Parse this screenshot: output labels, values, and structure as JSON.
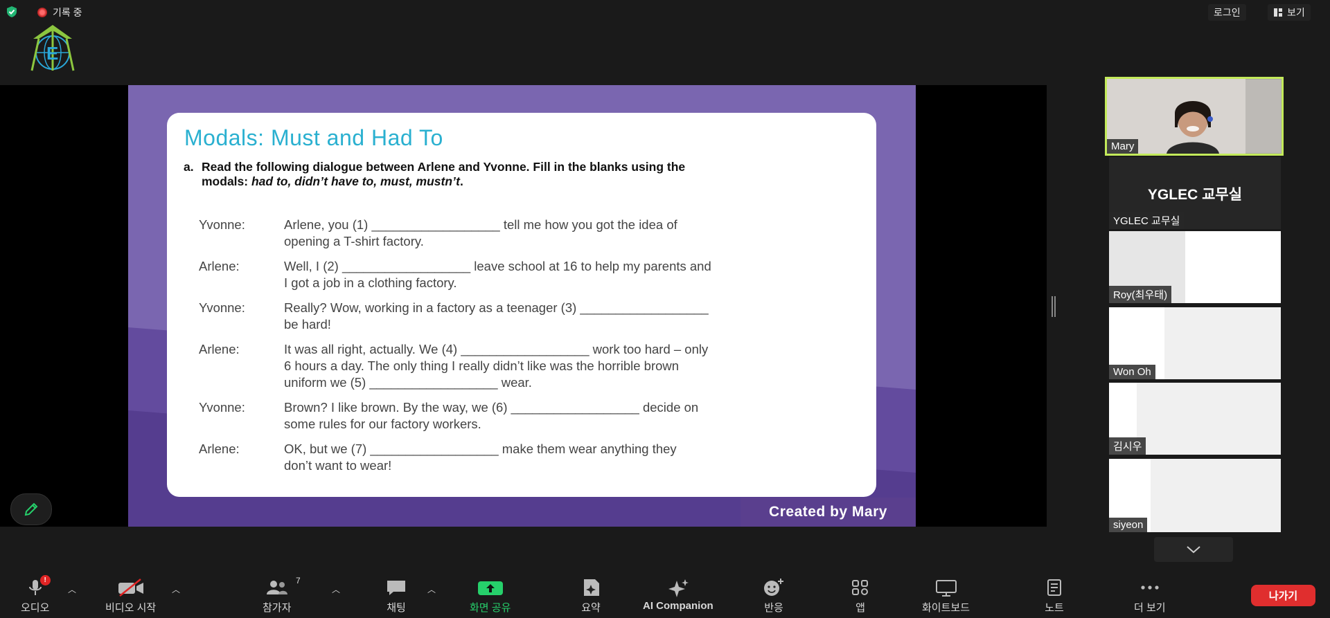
{
  "topbar": {
    "recording_label": "기록 중",
    "login_label": "로그인",
    "view_label": "보기"
  },
  "slide": {
    "title": "Modals: Must and Had To",
    "instruction_number": "a.",
    "instruction_line1": "Read the following dialogue between Arlene and Yvonne. Fill in the blanks using the",
    "instruction_line2_prefix": "modals: ",
    "instruction_line2_italic": "had to, didn’t have to, must, mustn’t",
    "instruction_line2_suffix": ".",
    "dialogue": [
      {
        "speaker": "Yvonne:",
        "line1": "Arlene, you (1) __________________ tell me how you got the idea of",
        "line2": "opening a T-shirt factory."
      },
      {
        "speaker": "Arlene:",
        "line1": "Well, I (2) __________________ leave school at 16 to help my parents and",
        "line2": "I got a job in a clothing  factory."
      },
      {
        "speaker": "Yvonne:",
        "line1": "Really? Wow, working in a factory as a teenager (3) __________________",
        "line2": "be hard!"
      },
      {
        "speaker": "Arlene:",
        "line1": "It was all right, actually. We (4) __________________ work too hard – only",
        "line2": "6 hours a day. The only thing I really didn’t like was the horrible brown",
        "line3": "uniform we (5) __________________ wear."
      },
      {
        "speaker": "Yvonne:",
        "line1": "Brown? I like brown. By the way, we (6) __________________ decide on",
        "line2": "some rules for our factory  workers."
      },
      {
        "speaker": "Arlene:",
        "line1": "OK, but we (7) __________________ make them wear anything they",
        "line2": "don’t want to wear!"
      }
    ],
    "credit": "Created by Mary"
  },
  "participants": [
    {
      "name": "Mary"
    },
    {
      "name": "YGLEC 교무실",
      "display_name": "YGLEC 교무실"
    },
    {
      "name": "Roy(최우태)"
    },
    {
      "name": "Won Oh"
    },
    {
      "name": "김시우"
    },
    {
      "name": "siyeon"
    }
  ],
  "toolbar": {
    "audio": {
      "label": "오디오",
      "badge": "!"
    },
    "video": {
      "label": "비디오 시작"
    },
    "participants": {
      "label": "참가자",
      "count": "7"
    },
    "chat": {
      "label": "채팅"
    },
    "share": {
      "label": "화면 공유"
    },
    "summary": {
      "label": "요약"
    },
    "ai": {
      "label": "AI Companion"
    },
    "reactions": {
      "label": "반응"
    },
    "apps": {
      "label": "앱"
    },
    "whiteboard": {
      "label": "화이트보드"
    },
    "notes": {
      "label": "노트"
    },
    "more": {
      "label": "더 보기"
    },
    "leave": {
      "label": "나가기"
    }
  },
  "colors": {
    "accent_green": "#26d06b",
    "leave_red": "#e02e2e",
    "slide_purple": "#7a66b0",
    "title_blue": "#2ab0d0",
    "active_speaker": "#c3ea5a"
  }
}
